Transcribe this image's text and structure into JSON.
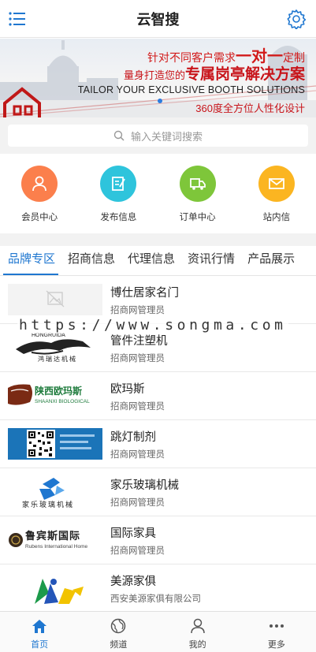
{
  "header": {
    "title": "云智搜"
  },
  "banner": {
    "line1_pre": "针对不同客户需求",
    "line1_big": "一对一",
    "line1_post": "定制",
    "line2_pre": "量身打造您的",
    "line2_big": "专属岗亭解决方案",
    "line3": "TAILOR YOUR EXCLUSIVE BOOTH SOLUTIONS",
    "line4": "360度全方位人性化设计"
  },
  "search": {
    "placeholder": "输入关键词搜索"
  },
  "quick_entries": [
    {
      "label": "会员中心",
      "icon": "user-icon",
      "color": "#fb7f4c"
    },
    {
      "label": "发布信息",
      "icon": "edit-icon",
      "color": "#2ec4dc"
    },
    {
      "label": "订单中心",
      "icon": "truck-icon",
      "color": "#7ec63a"
    },
    {
      "label": "站内信",
      "icon": "mail-icon",
      "color": "#fbb521"
    }
  ],
  "tabs": [
    {
      "label": "品牌专区",
      "active": true
    },
    {
      "label": "招商信息"
    },
    {
      "label": "代理信息"
    },
    {
      "label": "资讯行情"
    },
    {
      "label": "产品展示"
    }
  ],
  "listings": [
    {
      "name": "博仕居家名门",
      "sub": "招商网管理员",
      "logo": "image-placeholder-icon"
    },
    {
      "name": "管件注塑机",
      "sub": "招商网管理员",
      "logo": "hongruida-logo",
      "logo_text": "HONGRUIDA",
      "logo_cn": "鸿瑞达机械"
    },
    {
      "name": "欧玛斯",
      "sub": "招商网管理员",
      "logo": "shaanxi-biological-logo",
      "logo_cn": "陕西欧玛斯",
      "logo_text": "SHAANXI BIOLOGICAL"
    },
    {
      "name": "跳灯制剂",
      "sub": "招商网管理员",
      "logo": "qr-code-image"
    },
    {
      "name": "家乐玻璃机械",
      "sub": "招商网管理员",
      "logo": "jiale-glass-logo",
      "logo_cn": "家乐玻璃机械"
    },
    {
      "name": "国际家具",
      "sub": "招商网管理员",
      "logo": "rubens-logo",
      "logo_cn": "鲁宾斯国际",
      "logo_text": "Rubens International Home"
    },
    {
      "name": "美源家俱",
      "sub": "西安美源家俱有限公司",
      "logo": "meiyuan-logo"
    }
  ],
  "watermark": "https://www.songma.com",
  "bottom_nav": [
    {
      "label": "首页",
      "icon": "home-icon",
      "active": true
    },
    {
      "label": "频道",
      "icon": "globe-icon"
    },
    {
      "label": "我的",
      "icon": "person-icon"
    },
    {
      "label": "更多",
      "icon": "more-icon"
    }
  ],
  "colors": {
    "accent": "#1f77d0",
    "banner_red": "#c8141a"
  }
}
